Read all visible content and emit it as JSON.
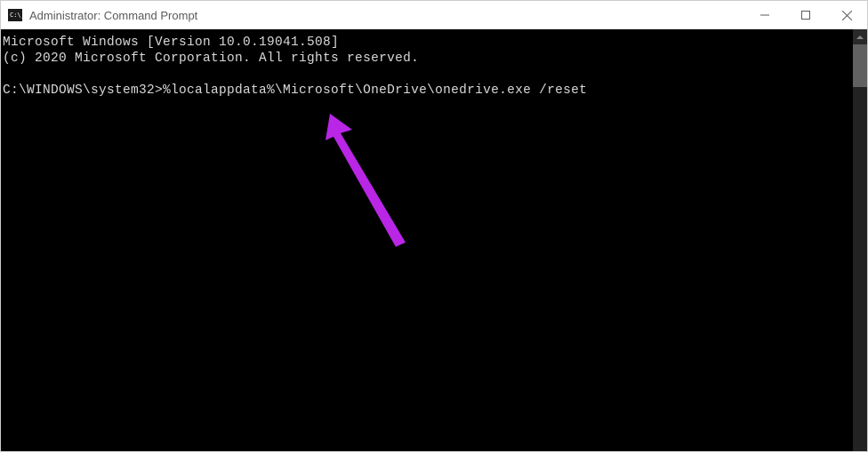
{
  "window": {
    "title": "Administrator: Command Prompt",
    "icon_label": "C:\\_"
  },
  "terminal": {
    "line1": "Microsoft Windows [Version 10.0.19041.508]",
    "line2": "(c) 2020 Microsoft Corporation. All rights reserved.",
    "prompt": "C:\\WINDOWS\\system32>",
    "command": "%localappdata%\\Microsoft\\OneDrive\\onedrive.exe /reset"
  },
  "annotation": {
    "arrow_color": "#b926e6"
  }
}
